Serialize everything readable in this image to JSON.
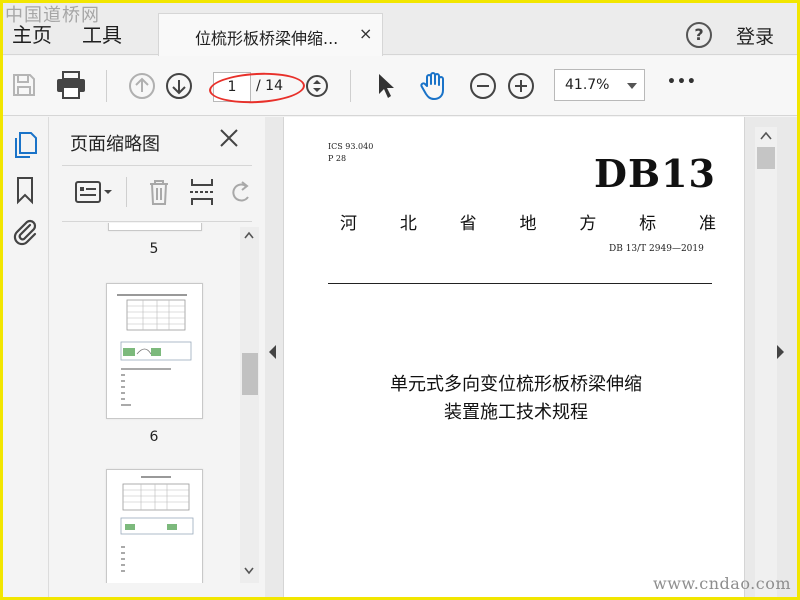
{
  "watermarks": {
    "top": "中国道桥网",
    "bottom": "www.cndao.com"
  },
  "menubar": {
    "home": "主页",
    "tools": "工具",
    "tab_title": "位梳形板桥梁伸缩...",
    "tab_close": "×",
    "help": "?",
    "login": "登录"
  },
  "toolbar": {
    "page_current": "1",
    "page_total": "/ 14",
    "zoom": "41.7%",
    "more": "•••"
  },
  "thumbnails": {
    "title": "页面缩略图",
    "pages": [
      {
        "label": "5"
      },
      {
        "label": "6"
      }
    ]
  },
  "document": {
    "ics": "ICS 93.040",
    "classification": "P 28",
    "db_code": "DB13",
    "standard_chars": [
      "河",
      "北",
      "省",
      "地",
      "方",
      "标",
      "准"
    ],
    "standard_number": "DB 13/T 2949—2019",
    "title_line1": "单元式多向变位梳形板桥梁伸缩",
    "title_line2": "装置施工技术规程"
  },
  "colors": {
    "accent_blue": "#1a73c8",
    "annotation_red": "#e8302a"
  }
}
